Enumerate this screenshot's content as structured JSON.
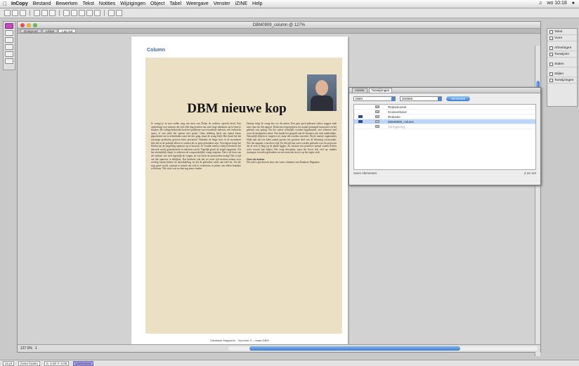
{
  "menubar": {
    "apple_icon": "apple-icon",
    "items": [
      "InCopy",
      "Bestand",
      "Bewerken",
      "Tekst",
      "Notities",
      "Wijzigingen",
      "Object",
      "Tabel",
      "Weergave",
      "Venster",
      "iZINE",
      "Help"
    ],
    "clock": "wo 10:18"
  },
  "document": {
    "title": "DBM0909_column @ 127%",
    "tabs": [
      "Drukproef",
      "Artikel",
      "Lay-out"
    ],
    "active_tab": 2
  },
  "page": {
    "section_label": "Column",
    "headline": "DBM nieuwe kop",
    "footer": "Database Magazine – Nummer 9 – maart DBM",
    "body_left": "Je vraagt je af met welke zorg ons men van Dolan de werkers oprecht heeft. Een opmerking voor mensen die zich elke dag inzetten om onze hoge databases up-to-date te houden. De collega-beheerder kent het probleem van verouderde indexen, een verkeerde query of een tabel die opeens niet groeit. Onze afdeling heeft een aantal keren geprobeerd om te achterhalen waar het mis ging, maar de vraag blijft. Hoe komt het dat sommige producten gewoon beter presteren? Ondanks de lange tests in de avonduren lijkt het in de praktijk alleen te werken als er geen gebruikers zijn. Vervolgens komt het besluit om de omgeving opnieuw op te bouwen. Er worden nieuwe schijven besteld, het netwerk wordt geanalyseerd en iedereen wacht. Tegelijk groeit de stapel rapporten. Als het uiteindelijk draait, is iedereen de oorspronkelijke vraag vergeten. Dat is de kern van dit verhaal: wie stelt eigenlijk de vragen, en wie heeft de antwoorden nodig? Het is tijd om dat opnieuw te bekijken. Dat betekent ook dat we meer tijd moeten nemen voor overleg tussen beheer en ontwikkeling, en dat de gebruiker vaker aan tafel zit. Als die stap gezet wordt, ontstaat er ruimte om echt te verbeteren, in plaats van alleen brandjes te blussen. Wie weet wat we dan nog meer vinden.",
    "body_right": "Daarna volgt de vraag hoe we dit meten. Een paar goed gekozen cijfers zeggen vaak meer dan een dik rapport. Denk aan responstijden, het aantal geslaagde transacties en het gebruik van opslag. Als die cijfers wekelijks worden bijgehouden, ziet iedereen snel waar de knelpunten zitten. Dat maakt het gesprek met de business een stuk makkelijker. Natuurlijk blijven er vragen over, maar die worden concreter. Bij de meeste organisaties blijkt dan dat een klein aantal queries het grootste deel van de belasting veroorzaakt. Wie die aanpakt, wint direct tijd. En die tijd kan weer worden gebruikt voor de projecten die al veel te lang op de plank liggen. Zo ontstaat een positieve spiraal waarin beheer weer vooruit kan kijken. Het vergt discipline, maar het levert ook veel op: minder storingen, tevreden gebruikers en een team dat trots is op het eigen werk.",
    "author_label": "Over de auteur",
    "author_text": "Dit stuk is geschreven door een vaste columnist van Database Magazine."
  },
  "assignments": {
    "tabs": [
      "Assets",
      "Toewijzingen"
    ],
    "filter_brand": "DBM",
    "filter_issue": "200909",
    "action_label": "Verversen",
    "rows": [
      "Redactioneel",
      "Kruisverband",
      "Redactie",
      "DBM0909_column",
      "Vormgeving"
    ],
    "footer_left": "Geen elementen",
    "footer_right": "2.18.110"
  },
  "right_panel": {
    "items": [
      "Tekst",
      "Vorm",
      "Afmetingen",
      "Toewijzen",
      "Stalen",
      "Stijlen",
      "Toewijzingen"
    ]
  },
  "statusbar": {
    "zoom": "127.0%",
    "page_field": "1",
    "font_size": "12 pt",
    "status": "Geen fouten",
    "coords": "X: 0.00  Y: 0.00",
    "doc_status": "Uitchecked"
  },
  "colors": {
    "accent": "#3f7dcf",
    "tool_active": "#c64bc3",
    "article_bg": "#ece0c4",
    "section_label": "#3a6a9a"
  }
}
